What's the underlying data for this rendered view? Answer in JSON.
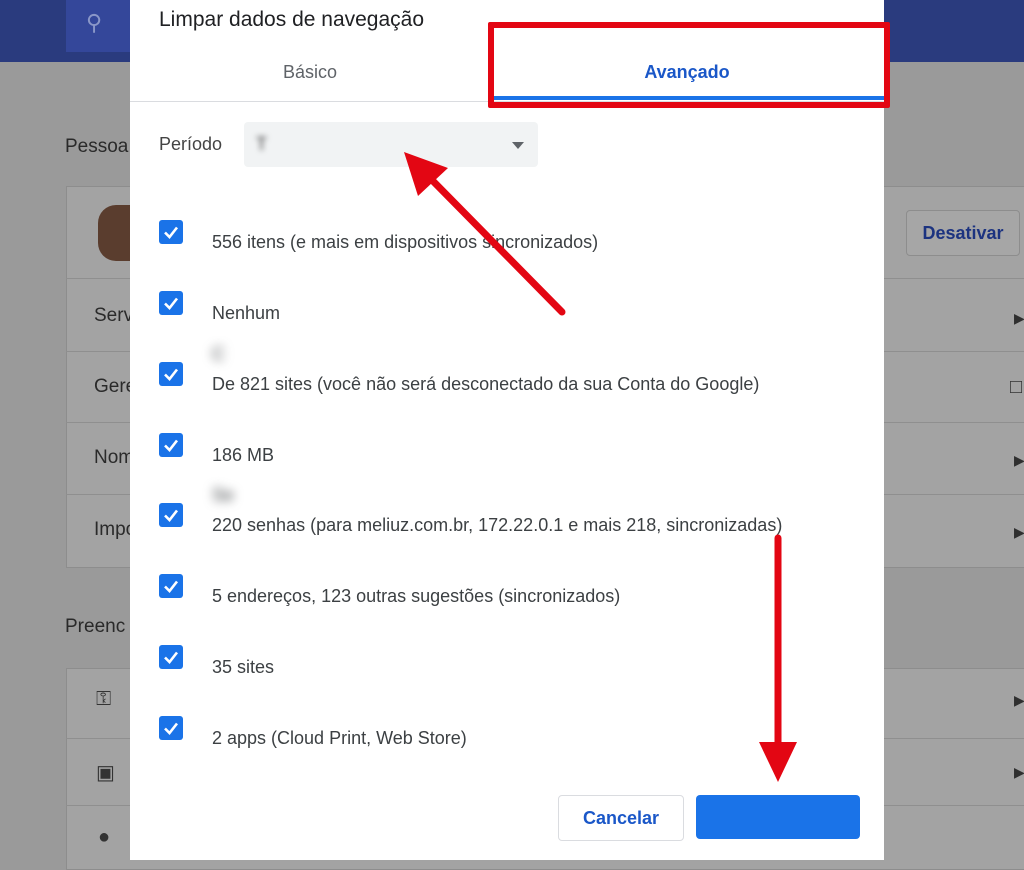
{
  "background": {
    "sections": [
      "Pessoa",
      "Preenc"
    ],
    "rows": [
      "Serv",
      "Gere",
      "Nom",
      "Impo"
    ],
    "deactivate_label": "Desativar"
  },
  "dialog": {
    "title": "Limpar dados de navegação",
    "tabs": [
      {
        "label": "Básico",
        "selected": false
      },
      {
        "label": "Avançado",
        "selected": true
      }
    ],
    "period": {
      "label": "Período",
      "value": "T"
    },
    "items": [
      {
        "title": "",
        "detail": "556 itens (e mais em dispositivos sincronizados)",
        "checked": true
      },
      {
        "title": "",
        "detail": "Nenhum",
        "checked": true
      },
      {
        "title": "C",
        "detail": "De 821 sites (você não será desconectado da sua Conta do Google)",
        "checked": true
      },
      {
        "title": "",
        "detail": "186 MB",
        "checked": true
      },
      {
        "title": "Se",
        "detail": "220 senhas (para meliuz.com.br, 172.22.0.1 e mais 218, sincronizadas)",
        "checked": true
      },
      {
        "title": "",
        "detail": "5 endereços, 123 outras sugestões (sincronizados)",
        "checked": true
      },
      {
        "title": "",
        "detail": "35 sites",
        "checked": true
      },
      {
        "title": "",
        "detail": "2 apps (Cloud Print, Web Store)",
        "checked": true
      }
    ],
    "buttons": {
      "cancel": "Cancelar",
      "confirm": ""
    }
  },
  "colors": {
    "accent": "#1a73e8",
    "annotation": "#e30613"
  }
}
